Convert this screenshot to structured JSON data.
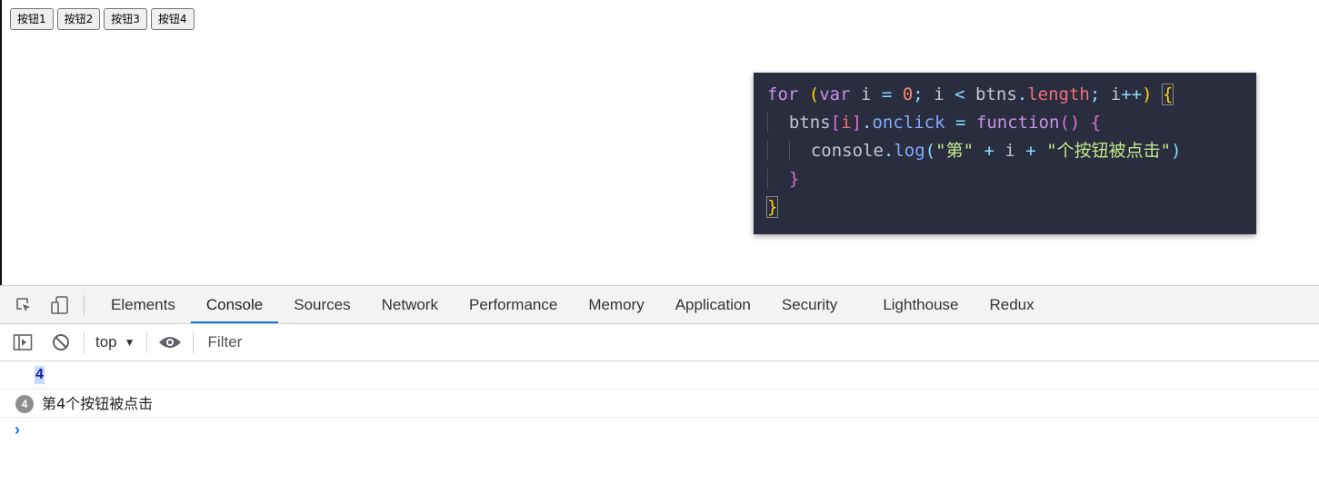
{
  "page": {
    "buttons": [
      "按钮1",
      "按钮2",
      "按钮3",
      "按钮4"
    ]
  },
  "code": {
    "line1": {
      "kw_for": "for",
      "paren_open": "(",
      "kw_var": "var",
      "var_i": "i",
      "eq": "=",
      "zero": "0",
      "semi": ";",
      "i2": "i",
      "lt": "<",
      "btns": "btns",
      "dot": ".",
      "length": "length",
      "semi2": ";",
      "i3": "i",
      "inc": "++",
      "paren_close": ")",
      "brace": "{"
    },
    "line2": {
      "btns": "btns",
      "bracket_open": "[",
      "i": "i",
      "bracket_close": "]",
      "dot": ".",
      "onclick": "onclick",
      "eq": "=",
      "kw_function": "function",
      "parens": "()",
      "brace": "{"
    },
    "line3": {
      "console": "console",
      "dot": ".",
      "log": "log",
      "paren_open": "(",
      "str1": "\"第\"",
      "plus1": "+",
      "i": "i",
      "plus2": "+",
      "str2": "\"个按钮被点击\"",
      "paren_close": ")"
    },
    "line4": {
      "brace": "}"
    },
    "line5": {
      "brace": "}"
    }
  },
  "devtools": {
    "tabs": [
      "Elements",
      "Console",
      "Sources",
      "Network",
      "Performance",
      "Memory",
      "Application",
      "Security",
      "Lighthouse",
      "Redux"
    ],
    "active_tab": "Console",
    "toolbar": {
      "context": "top",
      "context_arrow": "▼",
      "filter_placeholder": "Filter"
    },
    "console": {
      "value_output": "4",
      "repeat_count": "4",
      "log_message": "第4个按钮被点击",
      "prompt_symbol": "›"
    }
  }
}
